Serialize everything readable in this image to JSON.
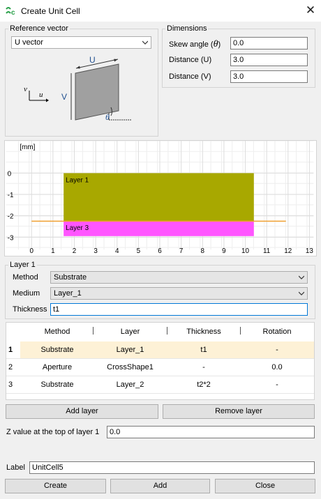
{
  "window": {
    "title": "Create Unit Cell",
    "close_glyph": "✕"
  },
  "reference_vector": {
    "group_title": "Reference vector",
    "selected": "U vector",
    "diagram": {
      "u_axis": "u",
      "v_axis": "v",
      "edge_u": "U",
      "edge_v": "V",
      "angle": "θ"
    }
  },
  "dimensions": {
    "group_title": "Dimensions",
    "skew_label": "Skew angle (",
    "skew_symbol": "θ",
    "skew_close": ")",
    "skew_value": "0.0",
    "dist_u_label": "Distance (U)",
    "dist_u_value": "3.0",
    "dist_v_label": "Distance (V)",
    "dist_v_value": "3.0"
  },
  "chart_data": {
    "type": "bar",
    "unit_label": "[mm]",
    "xlim": [
      0,
      13
    ],
    "ylim": [
      -3,
      0
    ],
    "x_ticks": [
      "0",
      "1",
      "2",
      "3",
      "4",
      "5",
      "6",
      "7",
      "8",
      "9",
      "10",
      "11",
      "12",
      "13"
    ],
    "y_ticks": [
      "0",
      "-1",
      "-2",
      "-3"
    ],
    "grid": true,
    "layers": [
      {
        "name": "Layer 1",
        "x": [
          1.5,
          10.4
        ],
        "y": [
          -2.25,
          0
        ],
        "color": "#a8a800"
      },
      {
        "name": "Layer 3",
        "x": [
          1.5,
          10.4
        ],
        "y": [
          -2.95,
          -2.25
        ],
        "color": "#ff55ff"
      }
    ],
    "aperture_line": {
      "x": [
        0,
        11.9
      ],
      "y": -2.25,
      "color": "#f0a030"
    }
  },
  "layer_editor": {
    "group_title": "Layer 1",
    "method_label": "Method",
    "method_value": "Substrate",
    "medium_label": "Medium",
    "medium_value": "Layer_1",
    "thickness_label": "Thickness",
    "thickness_value": "t1"
  },
  "table": {
    "columns": [
      "Method",
      "Layer",
      "Thickness",
      "Rotation"
    ],
    "rows": [
      {
        "num": "1",
        "method": "Substrate",
        "layer": "Layer_1",
        "thickness": "t1",
        "rotation": "-"
      },
      {
        "num": "2",
        "method": "Aperture",
        "layer": "CrossShape1",
        "thickness": "-",
        "rotation": "0.0"
      },
      {
        "num": "3",
        "method": "Substrate",
        "layer": "Layer_2",
        "thickness": "t2*2",
        "rotation": "-"
      }
    ]
  },
  "buttons": {
    "add_layer": "Add layer",
    "remove_layer": "Remove layer",
    "create": "Create",
    "add": "Add",
    "close": "Close"
  },
  "z_value": {
    "label": "Z value at the top of layer 1",
    "value": "0.0"
  },
  "label": {
    "label": "Label",
    "value": "UnitCell5"
  }
}
